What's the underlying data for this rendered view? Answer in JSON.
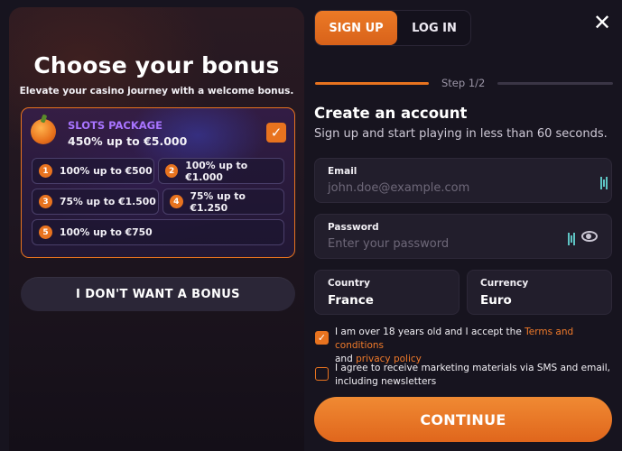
{
  "bonus": {
    "title": "Choose your bonus",
    "subtitle": "Elevate your casino journey with a welcome bonus.",
    "package": {
      "name": "SLOTS PACKAGE",
      "offer": "450% up to €5.000",
      "selected": true
    },
    "options": [
      {
        "num": "1",
        "text": "100% up to €500"
      },
      {
        "num": "2",
        "text": "100% up to €1.000"
      },
      {
        "num": "3",
        "text": "75% up to €1.500"
      },
      {
        "num": "4",
        "text": "75% up to €1.250"
      },
      {
        "num": "5",
        "text": "100% up to €750"
      }
    ],
    "no_bonus_label": "I DON'T WANT A BONUS"
  },
  "auth": {
    "tabs": {
      "signup": "SIGN UP",
      "login": "LOG IN",
      "active": "signup"
    },
    "close_glyph": "✕",
    "step": "Step 1/2",
    "title": "Create an account",
    "lead": "Sign up and start playing in less than 60 seconds.",
    "email": {
      "label": "Email",
      "placeholder": "john.doe@example.com"
    },
    "password": {
      "label": "Password",
      "placeholder": "Enter your password"
    },
    "country": {
      "label": "Country",
      "value": "France"
    },
    "currency": {
      "label": "Currency",
      "value": "Euro"
    },
    "terms": {
      "checked": true,
      "text_before": "I am over 18 years old and I accept the ",
      "terms_link": "Terms and conditions",
      "and": "and ",
      "privacy_link": "privacy policy"
    },
    "marketing": {
      "checked": false,
      "line1": "I agree to receive marketing materials via SMS and email,",
      "line2": "including newsletters"
    },
    "continue_label": "CONTINUE"
  },
  "colors": {
    "accent": "#e8731f",
    "background": "#17141f",
    "purple_label": "#a874ff",
    "password_manager_icon": "#5ec4c4"
  },
  "icons": [
    "orange-fruit-icon",
    "checkmark-icon",
    "close-icon",
    "password-manager-icon",
    "eye-icon"
  ]
}
